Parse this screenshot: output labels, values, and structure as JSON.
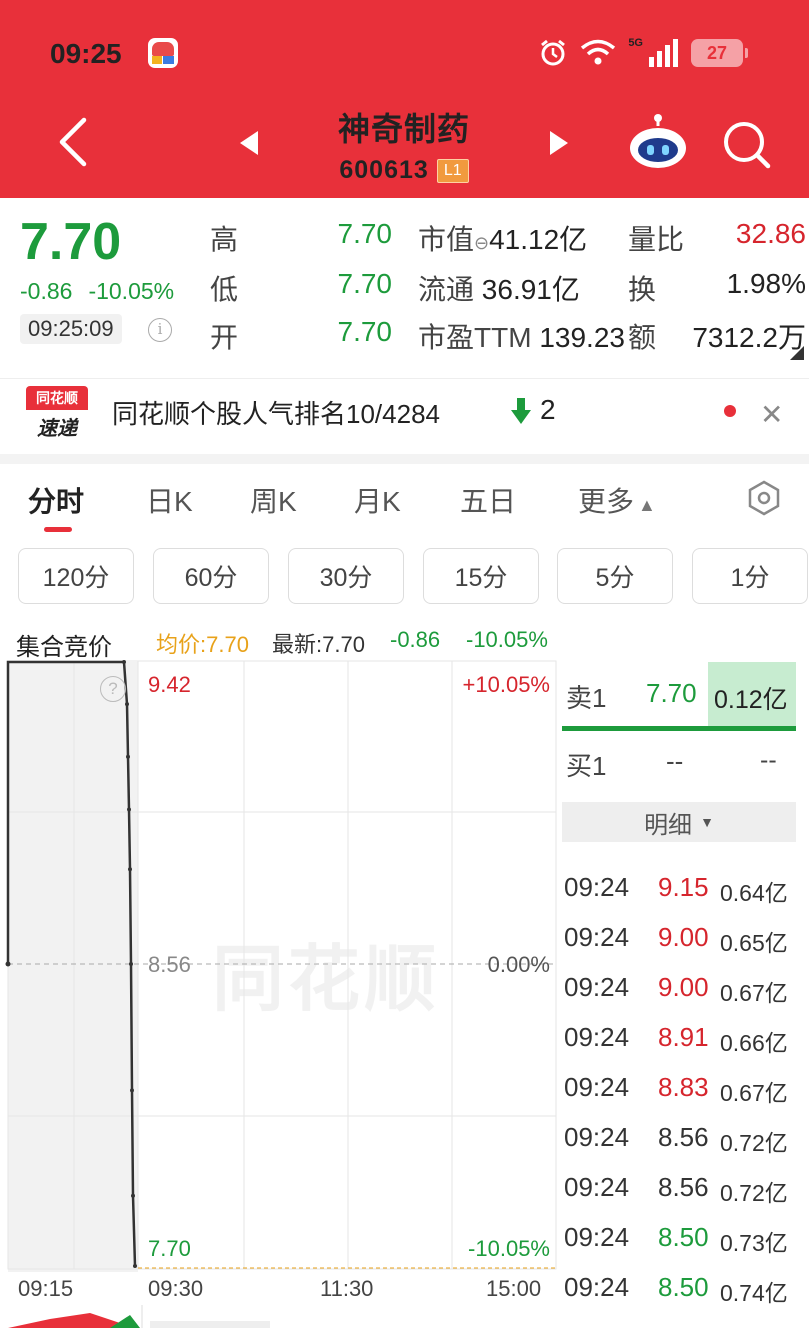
{
  "status_bar": {
    "time": "09:25",
    "network": "5G",
    "battery": "27"
  },
  "header": {
    "title": "神奇制药",
    "code": "600613",
    "level_badge": "L1"
  },
  "quote": {
    "price": "7.70",
    "change": "-0.86",
    "change_pct": "-10.05%",
    "time": "09:25:09",
    "rows": [
      {
        "label": "高",
        "value": "7.70"
      },
      {
        "label": "低",
        "value": "7.70"
      },
      {
        "label": "开",
        "value": "7.70"
      }
    ],
    "market_cap_label": "市值",
    "market_cap": "41.12亿",
    "float_label": "流通",
    "float_value": "36.91亿",
    "pe_label": "市盈TTM",
    "pe_value": "139.23",
    "vol_ratio_label": "量比",
    "vol_ratio": "32.86",
    "turnover_label": "换",
    "turnover": "1.98%",
    "amount_label": "额",
    "amount": "7312.2万"
  },
  "news": {
    "logo_top": "同花顺",
    "logo_bottom": "速递",
    "text": "同花顺个股人气排名10/4284",
    "rank_change": "2"
  },
  "tabs": [
    "分时",
    "日K",
    "周K",
    "月K",
    "五日",
    "更多"
  ],
  "periods": [
    "120分",
    "60分",
    "30分",
    "15分",
    "5分",
    "1分"
  ],
  "chart_head": {
    "auction_label": "集合竞价",
    "avg_label": "均价:7.70",
    "latest_label": "最新:7.70",
    "change": "-0.86",
    "change_pct": "-10.05%"
  },
  "chart_data": {
    "type": "line",
    "title": "",
    "y_labels": {
      "top": "9.42",
      "mid": "8.56",
      "bottom": "7.70"
    },
    "pct_labels": {
      "top": "+10.05%",
      "mid": "0.00%",
      "bottom": "-10.05%"
    },
    "x_labels": [
      "09:15",
      "09:30",
      "11:30",
      "15:00"
    ],
    "ylim": [
      7.7,
      9.42
    ],
    "series": [
      {
        "values": [
          8.56,
          9.42,
          9.42,
          9.42,
          9.3,
          9.15,
          9.0,
          8.83,
          8.56,
          8.2,
          7.9,
          7.7
        ]
      }
    ],
    "grid": true
  },
  "order_book": {
    "sell_label": "卖1",
    "sell_price": "7.70",
    "sell_vol": "0.12亿",
    "buy_label": "买1",
    "buy_price": "--",
    "buy_vol": "--",
    "detail_label": "明细"
  },
  "ticks": [
    {
      "time": "09:24",
      "price": "9.15",
      "vol": "0.64亿",
      "color": "#d6252d"
    },
    {
      "time": "09:24",
      "price": "9.00",
      "vol": "0.65亿",
      "color": "#d6252d"
    },
    {
      "time": "09:24",
      "price": "9.00",
      "vol": "0.67亿",
      "color": "#d6252d"
    },
    {
      "time": "09:24",
      "price": "8.91",
      "vol": "0.66亿",
      "color": "#d6252d"
    },
    {
      "time": "09:24",
      "price": "8.83",
      "vol": "0.67亿",
      "color": "#d6252d"
    },
    {
      "time": "09:24",
      "price": "8.56",
      "vol": "0.72亿",
      "color": "#333333"
    },
    {
      "time": "09:24",
      "price": "8.56",
      "vol": "0.72亿",
      "color": "#333333"
    },
    {
      "time": "09:24",
      "price": "8.50",
      "vol": "0.73亿",
      "color": "#1d9b3c"
    },
    {
      "time": "09:24",
      "price": "8.50",
      "vol": "0.74亿",
      "color": "#1d9b3c"
    }
  ],
  "watermark": "同花顺",
  "colors": {
    "header_red": "#e8303a",
    "up_red": "#d6252d",
    "down_green": "#1d9b3c"
  }
}
